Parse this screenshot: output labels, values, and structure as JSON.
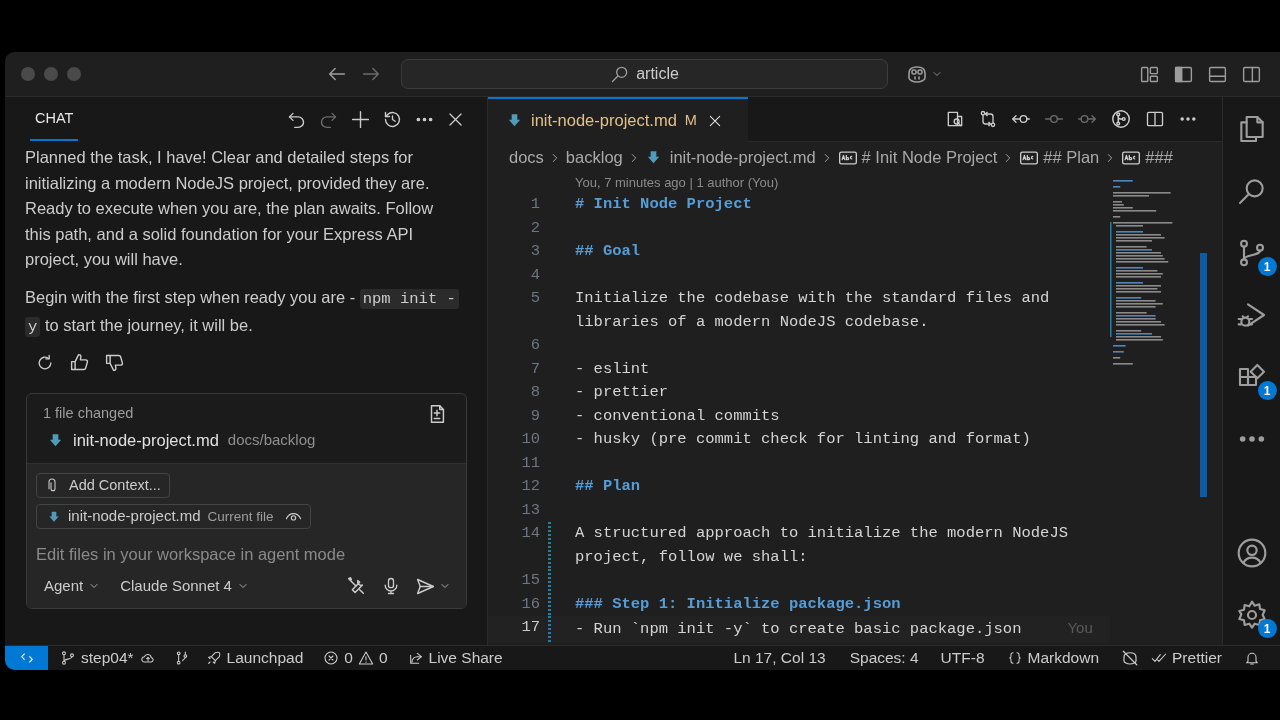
{
  "title_bar": {
    "search": "article"
  },
  "chat": {
    "tab": {
      "label": "CHAT",
      "selected": true
    },
    "messages": [
      [
        {
          "kind": "text",
          "text": "Planned the task, I have! Clear and detailed steps for initializing a modern NodeJS project, provided they are. Ready to execute when you are, the plan awaits. Follow this path, and a solid foundation for your Express API project, you will have."
        }
      ],
      [
        {
          "kind": "text",
          "text": "Begin with the first step when ready you are - "
        },
        {
          "kind": "code",
          "text": "npm init -y"
        },
        {
          "kind": "text",
          "text": " to start the journey, it will be."
        }
      ]
    ],
    "changes": {
      "summary": "1 file changed",
      "files": [
        {
          "name": "init-node-project.md",
          "path": "docs/backlog"
        }
      ]
    },
    "input": {
      "context_button": "Add Context...",
      "attachments": [
        {
          "name": "init-node-project.md",
          "label": "Current file"
        }
      ],
      "placeholder": "Edit files in your workspace in agent mode",
      "mode": "Agent",
      "model": "Claude Sonnet 4"
    }
  },
  "editor": {
    "tabs": [
      {
        "name": "init-node-project.md",
        "status": "M",
        "selected": true
      }
    ],
    "breadcrumbs": [
      {
        "kind": "folder",
        "text": "docs"
      },
      {
        "kind": "folder",
        "text": "backlog"
      },
      {
        "kind": "file",
        "text": "init-node-project.md"
      },
      {
        "kind": "symbol",
        "text": "# Init Node Project"
      },
      {
        "kind": "symbol",
        "text": "## Plan"
      },
      {
        "kind": "symbol",
        "text": "###"
      }
    ],
    "blame": "You, 7 minutes ago | 1 author (You)",
    "lines": [
      {
        "number": "1",
        "kind": "heading",
        "text": "# Init Node Project",
        "modified": false,
        "current": false
      },
      {
        "number": "2",
        "kind": "blank",
        "modified": false,
        "current": false
      },
      {
        "number": "3",
        "kind": "heading",
        "text": "## Goal",
        "modified": false,
        "current": false
      },
      {
        "number": "4",
        "kind": "blank",
        "modified": false,
        "current": false
      },
      {
        "number": "5",
        "kind": "text",
        "text": "Initialize the codebase with the standard files and libraries of a modern NodeJS codebase.",
        "modified": false,
        "current": false
      },
      {
        "number": "6",
        "kind": "blank",
        "modified": false,
        "current": false
      },
      {
        "number": "7",
        "kind": "text",
        "text": "- eslint",
        "modified": false,
        "current": false
      },
      {
        "number": "8",
        "kind": "text",
        "text": "- prettier",
        "modified": false,
        "current": false
      },
      {
        "number": "9",
        "kind": "text",
        "text": "- conventional commits",
        "modified": false,
        "current": false
      },
      {
        "number": "10",
        "kind": "text",
        "text": "- husky (pre commit check for linting and format)",
        "modified": false,
        "current": false
      },
      {
        "number": "11",
        "kind": "blank",
        "modified": false,
        "current": false
      },
      {
        "number": "12",
        "kind": "heading",
        "text": "## Plan",
        "modified": false,
        "current": false
      },
      {
        "number": "13",
        "kind": "blank",
        "modified": false,
        "current": false
      },
      {
        "number": "14",
        "kind": "text",
        "text": "A structured approach to initialize the modern NodeJS project, follow we shall:",
        "modified": true,
        "current": false
      },
      {
        "number": "15",
        "kind": "blank",
        "modified": true,
        "current": false
      },
      {
        "number": "16",
        "kind": "heading",
        "text": "### Step 1: Initialize package.json",
        "modified": true,
        "current": false
      },
      {
        "number": "17",
        "kind": "text",
        "text": "- Run `npm init -y` to create basic package.json",
        "modified": true,
        "current": true,
        "blame": "You"
      }
    ]
  },
  "activity_bar": {
    "source_control_badge": "1",
    "extensions_badge": "1",
    "settings_badge": "1"
  },
  "status_bar": {
    "branch": "step04*",
    "launchpad": "Launchpad",
    "errors": "0",
    "warnings": "0",
    "live_share": "Live Share",
    "cursor": "Ln 17, Col 13",
    "indentation": "Spaces: 4",
    "encoding": "UTF-8",
    "language": "Markdown",
    "formatter": "Prettier"
  }
}
